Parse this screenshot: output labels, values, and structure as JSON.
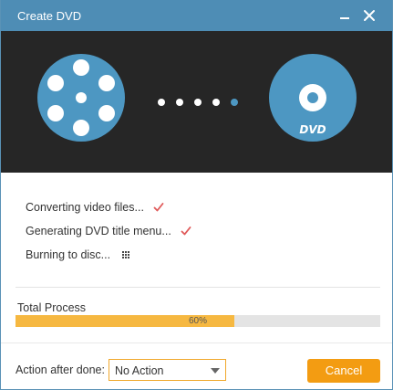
{
  "window": {
    "title": "Create DVD"
  },
  "hero": {
    "source_icon": "film-reel-icon",
    "target_icon": "dvd-disc-icon",
    "disc_label": "DVD",
    "progress_dots": 5
  },
  "steps": [
    {
      "label": "Converting video files...",
      "status": "done",
      "icon": "checkmark-icon"
    },
    {
      "label": "Generating DVD title menu...",
      "status": "done",
      "icon": "checkmark-icon"
    },
    {
      "label": "Burning to disc...",
      "status": "in-progress",
      "icon": "loading-grid-icon"
    }
  ],
  "process": {
    "label": "Total Process",
    "percent": 60,
    "percent_text": "60%"
  },
  "footer": {
    "action_label": "Action after done:",
    "action_value": "No Action",
    "cancel_label": "Cancel"
  },
  "colors": {
    "titlebar": "#4e8db5",
    "hero_bg": "#262626",
    "icon_blue": "#4d97c2",
    "accent_orange": "#f39c12",
    "progress_fill": "#f6b841",
    "check_red": "#e05a5a"
  }
}
